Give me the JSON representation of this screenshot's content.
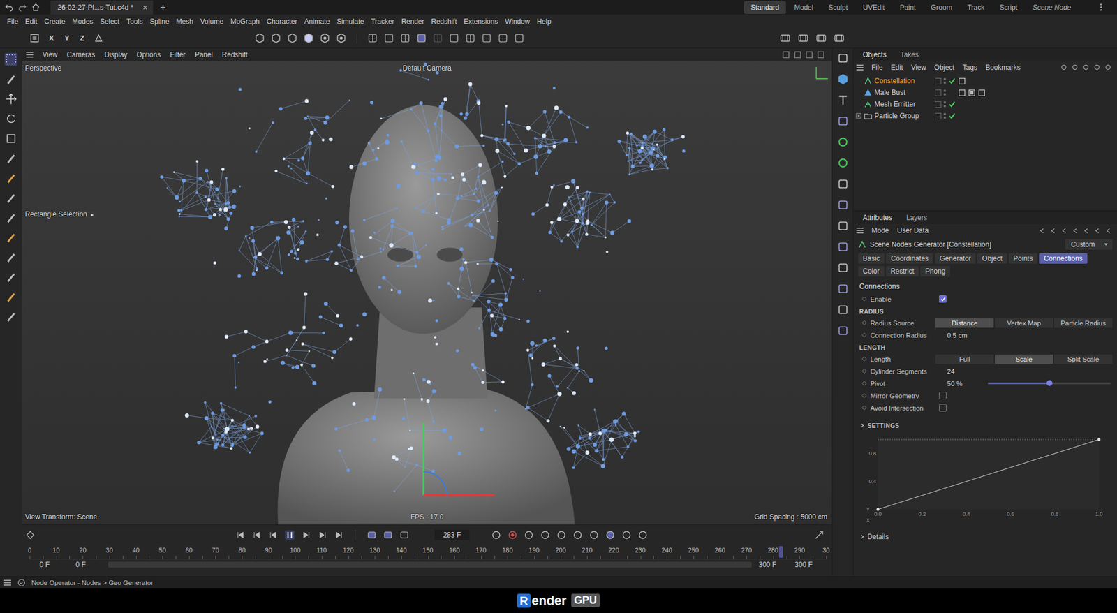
{
  "title_bar": {
    "file_tab": "26-02-27-Pl...s-Tut.c4d *",
    "close": "×",
    "add": "+",
    "layouts": [
      {
        "label": "Standard",
        "selected": true
      },
      {
        "label": "Model",
        "selected": false
      },
      {
        "label": "Sculpt",
        "selected": false
      },
      {
        "label": "UVEdit",
        "selected": false
      },
      {
        "label": "Paint",
        "selected": false
      },
      {
        "label": "Groom",
        "selected": false
      },
      {
        "label": "Track",
        "selected": false
      },
      {
        "label": "Script",
        "selected": false
      },
      {
        "label": "Scene Node",
        "selected": false
      }
    ]
  },
  "menu_bar": [
    "File",
    "Edit",
    "Create",
    "Modes",
    "Select",
    "Tools",
    "Spline",
    "Mesh",
    "Volume",
    "MoGraph",
    "Character",
    "Animate",
    "Simulate",
    "Tracker",
    "Render",
    "Redshift",
    "Extensions",
    "Window",
    "Help"
  ],
  "toolbar": {
    "axes": [
      "X",
      "Y",
      "Z"
    ]
  },
  "viewport": {
    "menu": [
      "View",
      "Cameras",
      "Display",
      "Options",
      "Filter",
      "Panel",
      "Redshift"
    ],
    "name": "Perspective",
    "camera": "Default Camera",
    "tool_label": "Rectangle Selection",
    "tool_arrow": "▸",
    "view_transform": "View Transform: Scene",
    "fps": "FPS : 17.0",
    "grid": "Grid Spacing : 5000 cm"
  },
  "objects_panel": {
    "tabs": [
      {
        "label": "Objects",
        "selected": true
      },
      {
        "label": "Takes",
        "selected": false
      }
    ],
    "menu": [
      "File",
      "Edit",
      "View",
      "Object",
      "Tags",
      "Bookmarks"
    ],
    "items": [
      {
        "name": "Constellation",
        "kind": "generator",
        "selected": true,
        "checked": true,
        "tag_count": 1
      },
      {
        "name": "Male Bust",
        "kind": "mesh",
        "selected": false,
        "checked": false,
        "tag_count": 3
      },
      {
        "name": "Mesh Emitter",
        "kind": "emitter",
        "selected": false,
        "checked": true,
        "tag_count": 0
      },
      {
        "name": "Particle Group",
        "kind": "group",
        "selected": false,
        "checked": true,
        "tag_count": 0
      }
    ]
  },
  "attributes": {
    "tabs": [
      {
        "label": "Attributes",
        "selected": true
      },
      {
        "label": "Layers",
        "selected": false
      }
    ],
    "menu": [
      "Mode",
      "User Data"
    ],
    "object_title": "Scene Nodes Generator [Constellation]",
    "preset": "Custom",
    "page_tabs": [
      {
        "label": "Basic",
        "selected": false
      },
      {
        "label": "Coordinates",
        "selected": false
      },
      {
        "label": "Generator",
        "selected": false
      },
      {
        "label": "Object",
        "selected": false
      },
      {
        "label": "Points",
        "selected": false
      },
      {
        "label": "Connections",
        "selected": true
      },
      {
        "label": "Color",
        "selected": false
      },
      {
        "label": "Restrict",
        "selected": false
      },
      {
        "label": "Phong",
        "selected": false
      }
    ],
    "section": "Connections",
    "rows": [
      {
        "kind": "checkbox",
        "label": "Enable",
        "checked": true
      },
      {
        "kind": "heading",
        "label": "RADIUS"
      },
      {
        "kind": "segmented",
        "label": "Radius Source",
        "options": [
          {
            "label": "Distance",
            "selected": true
          },
          {
            "label": "Vertex Map",
            "selected": false
          },
          {
            "label": "Particle Radius",
            "selected": false
          }
        ]
      },
      {
        "kind": "field",
        "label": "Connection Radius",
        "value": "0.5 cm"
      },
      {
        "kind": "heading",
        "label": "LENGTH"
      },
      {
        "kind": "segmented",
        "label": "Length",
        "options": [
          {
            "label": "Full",
            "selected": false
          },
          {
            "label": "Scale",
            "selected": true
          },
          {
            "label": "Split Scale",
            "selected": false
          }
        ]
      },
      {
        "kind": "field",
        "label": "Cylinder Segments",
        "value": "24"
      },
      {
        "kind": "slider",
        "label": "Pivot",
        "value": "50 %",
        "level": 0.5
      },
      {
        "kind": "checkbox",
        "label": "Mirror Geometry",
        "checked": false
      },
      {
        "kind": "checkbox",
        "label": "Avoid Intersection",
        "checked": false
      }
    ],
    "settings": {
      "label": "SETTINGS",
      "expanded": false
    },
    "graph": {
      "y_axis": "Y",
      "x_axis": "X",
      "y_ticks": [
        "0.8",
        "0.4"
      ],
      "x_ticks": [
        "0.0",
        "0.2",
        "0.4",
        "0.6",
        "0.8",
        "1.0"
      ],
      "values": [
        0.0,
        1.0
      ]
    },
    "details": {
      "label": "Details",
      "expanded": false
    }
  },
  "timeline": {
    "current_frame": "283 F",
    "playing": true,
    "ticks": [
      "0",
      "10",
      "20",
      "30",
      "40",
      "50",
      "60",
      "70",
      "80",
      "90",
      "100",
      "110",
      "120",
      "130",
      "140",
      "150",
      "160",
      "170",
      "180",
      "190",
      "200",
      "210",
      "220",
      "230",
      "240",
      "250",
      "260",
      "270",
      "280",
      "290",
      "30"
    ],
    "level": 0.943,
    "range_start": "0 F",
    "preview_start": "0 F",
    "preview_end": "300 F",
    "range_end": "300 F"
  },
  "status_bar": {
    "text": "Node Operator - Nodes > Geo Generator"
  },
  "watermark": {
    "mark": "R",
    "text": "ender",
    "badge": "GPU"
  }
}
